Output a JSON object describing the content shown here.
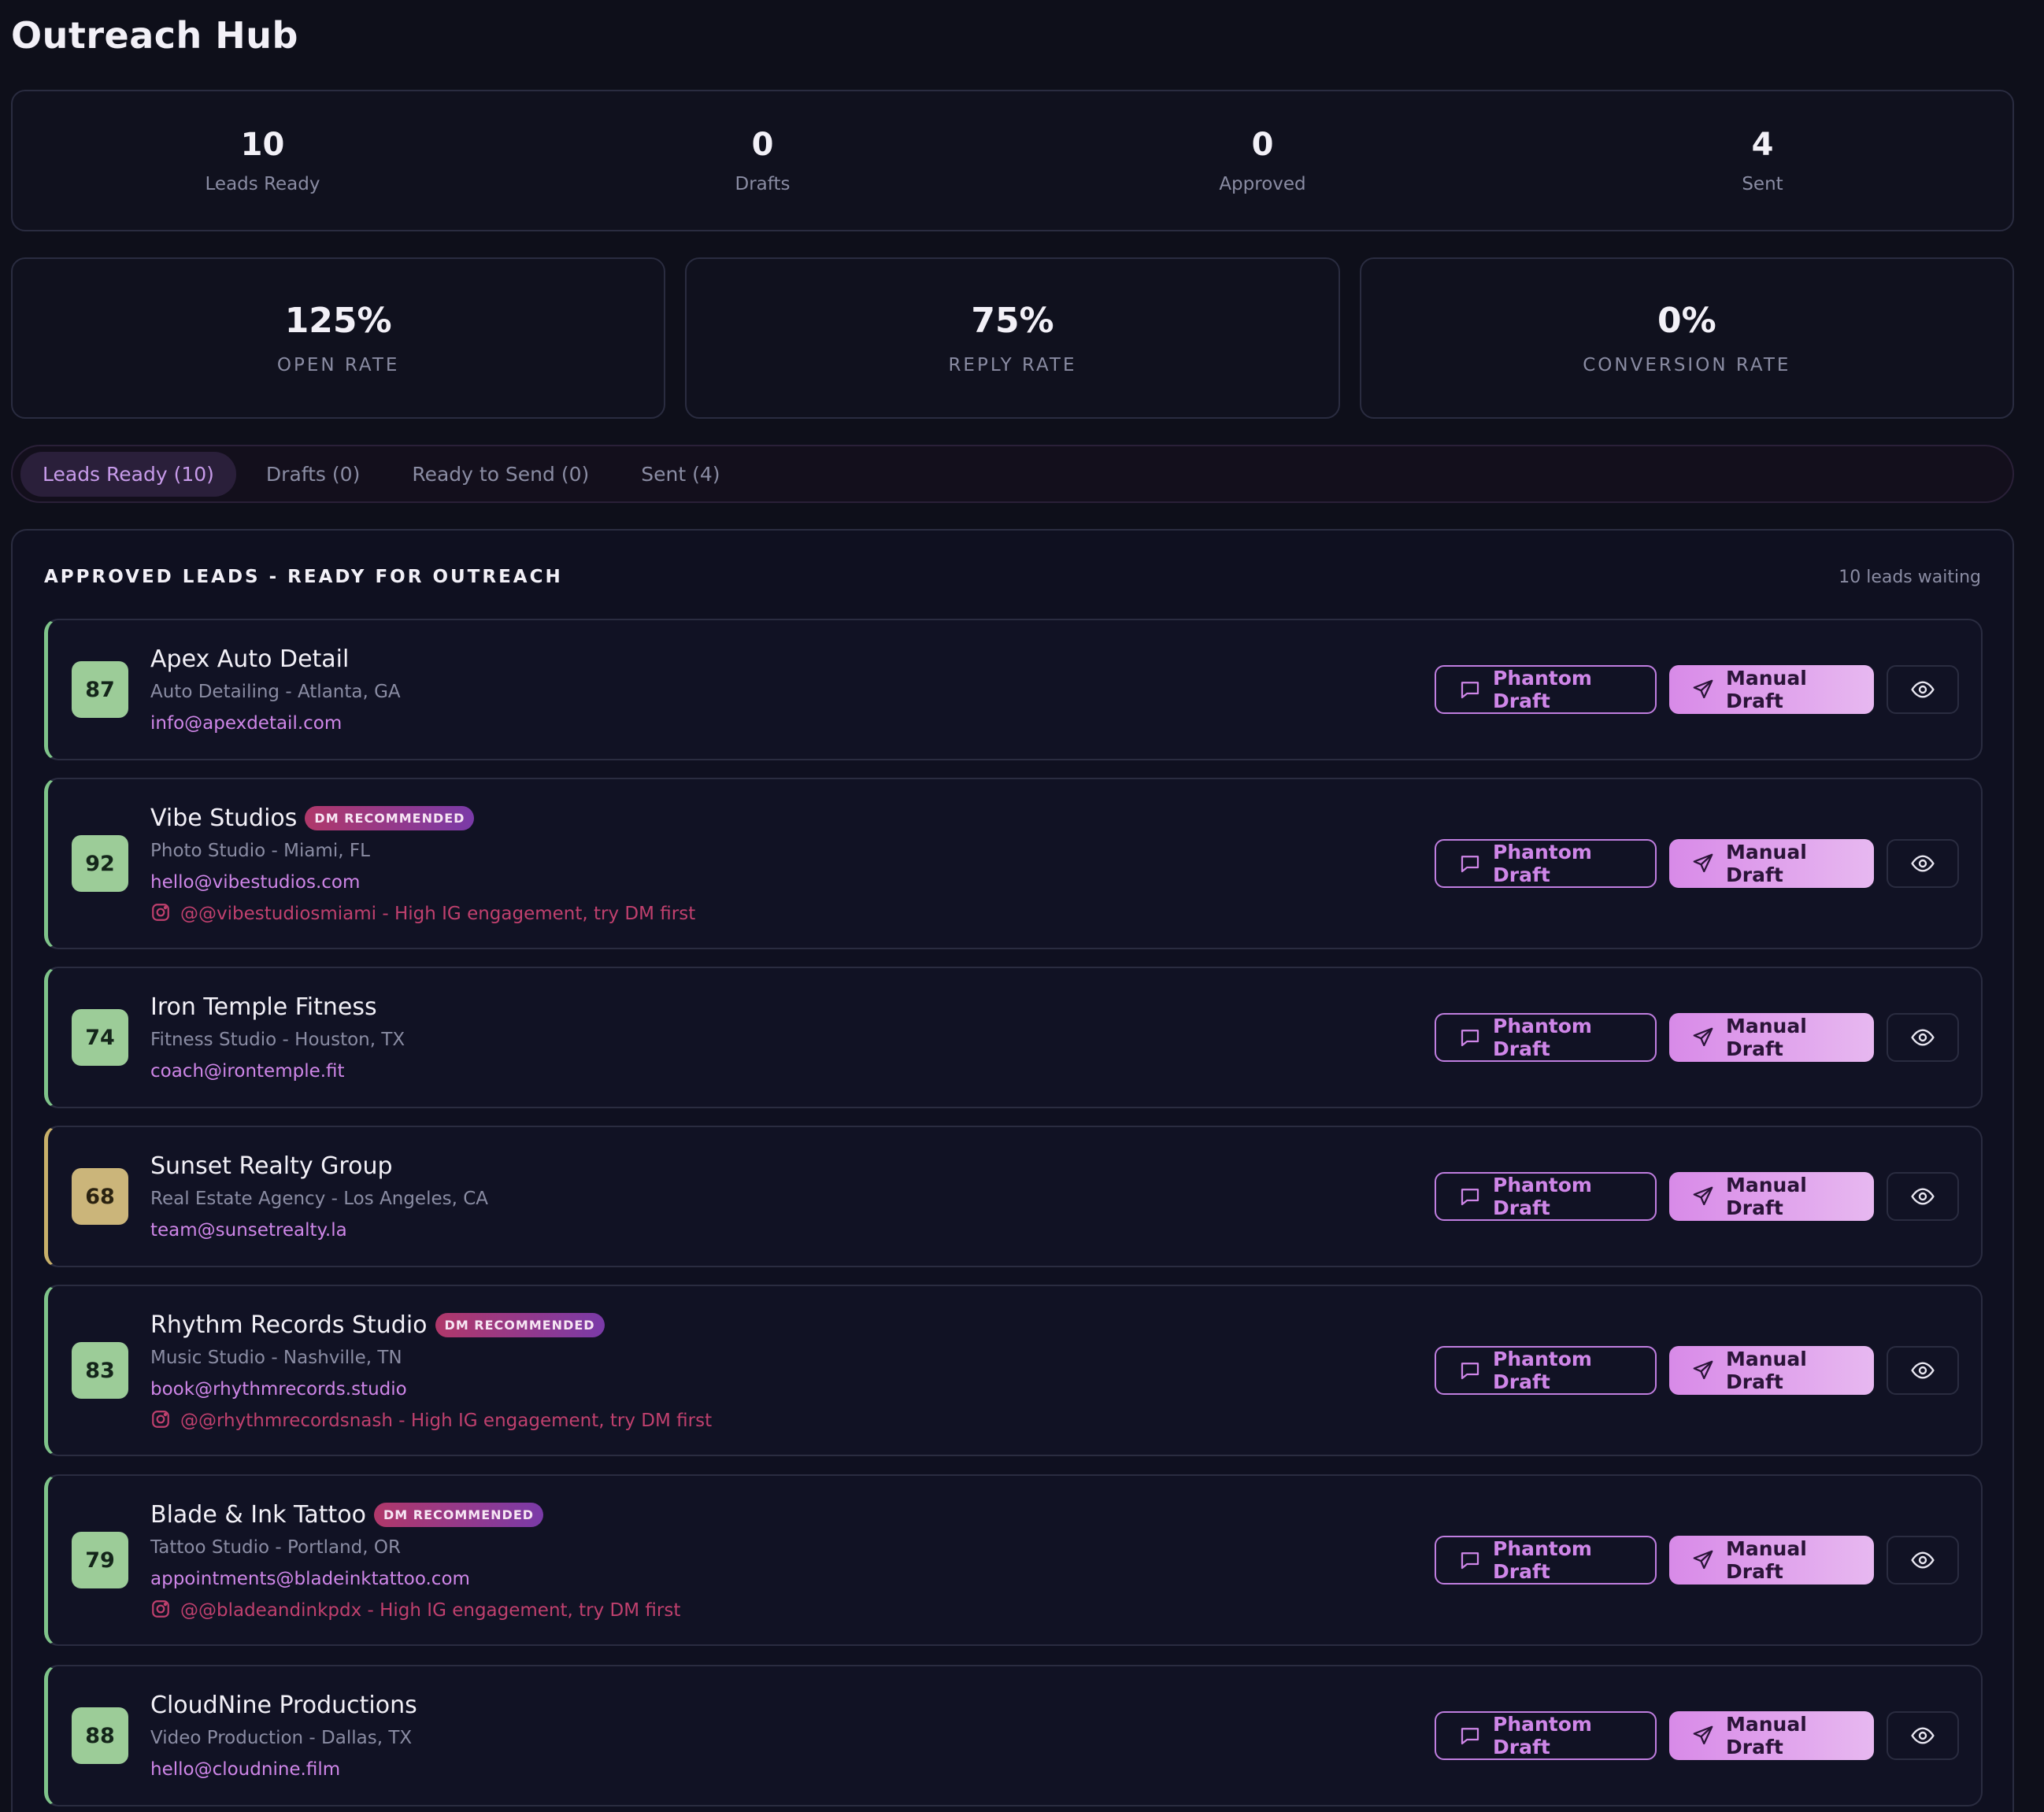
{
  "app": {
    "title": "Outreach Hub"
  },
  "stats": [
    {
      "value": "10",
      "label": "Leads Ready"
    },
    {
      "value": "0",
      "label": "Drafts"
    },
    {
      "value": "0",
      "label": "Approved"
    },
    {
      "value": "4",
      "label": "Sent"
    }
  ],
  "rates": [
    {
      "value": "125%",
      "label": "OPEN RATE"
    },
    {
      "value": "75%",
      "label": "REPLY RATE"
    },
    {
      "value": "0%",
      "label": "CONVERSION RATE"
    }
  ],
  "tabs": [
    {
      "label": "Leads Ready (10)",
      "active": true
    },
    {
      "label": "Drafts (0)"
    },
    {
      "label": "Ready to Send (0)"
    },
    {
      "label": "Sent (4)"
    }
  ],
  "panel": {
    "title": "APPROVED LEADS - READY FOR OUTREACH",
    "count": "10 leads waiting"
  },
  "buttons": {
    "phantom": "Phantom Draft",
    "manual": "Manual Draft"
  },
  "leads": [
    {
      "score": "87",
      "name": "Apex Auto Detail",
      "sub": "Auto Detailing - Atlanta, GA",
      "email": "info@apexdetail.com"
    },
    {
      "score": "92",
      "name": "Vibe Studios",
      "badge": "DM RECOMMENDED",
      "sub": "Photo Studio - Miami, FL",
      "email": "hello@vibestudios.com",
      "ig": "@@vibestudiosmiami - High IG engagement, try DM first"
    },
    {
      "score": "74",
      "name": "Iron Temple Fitness",
      "sub": "Fitness Studio - Houston, TX",
      "email": "coach@irontemple.fit"
    },
    {
      "score": "68",
      "name": "Sunset Realty Group",
      "sub": "Real Estate Agency - Los Angeles, CA",
      "email": "team@sunsetrealty.la"
    },
    {
      "score": "83",
      "name": "Rhythm Records Studio",
      "badge": "DM RECOMMENDED",
      "sub": "Music Studio - Nashville, TN",
      "email": "book@rhythmrecords.studio",
      "ig": "@@rhythmrecordsnash - High IG engagement, try DM first"
    },
    {
      "score": "79",
      "name": "Blade & Ink Tattoo",
      "badge": "DM RECOMMENDED",
      "sub": "Tattoo Studio - Portland, OR",
      "email": "appointments@bladeinktattoo.com",
      "ig": "@@bladeandinkpdx - High IG engagement, try DM first"
    },
    {
      "score": "88",
      "name": "CloudNine Productions",
      "sub": "Video Production - Dallas, TX",
      "email": "hello@cloudnine.film"
    }
  ]
}
